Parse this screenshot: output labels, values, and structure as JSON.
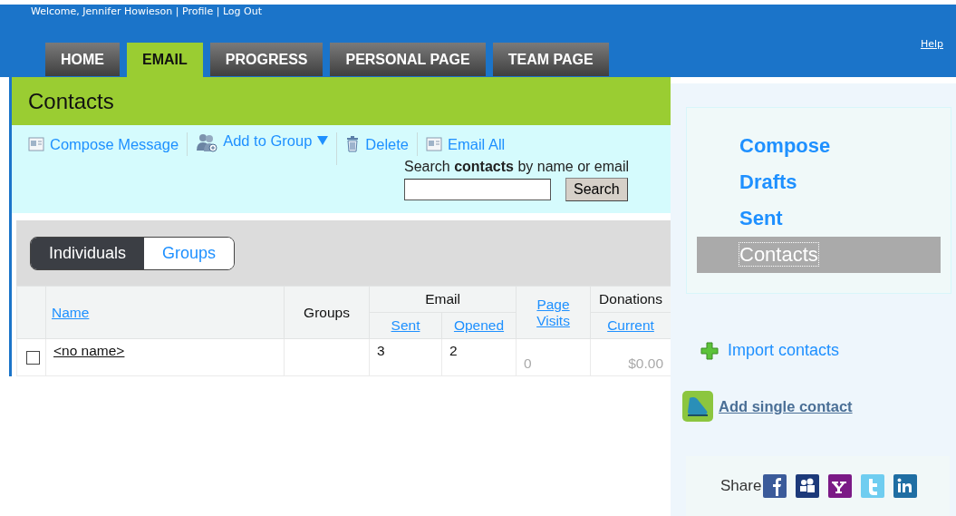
{
  "header": {
    "welcome": "Welcome, Jennifer Howieson",
    "links": [
      {
        "label": "Profile"
      },
      {
        "label": "Log Out"
      }
    ],
    "separators": [
      "|",
      "|"
    ],
    "help": "Help"
  },
  "tabs": [
    {
      "label": "HOME",
      "selected": false
    },
    {
      "label": "EMAIL",
      "selected": true
    },
    {
      "label": "PROGRESS",
      "selected": false
    },
    {
      "label": "PERSONAL PAGE",
      "selected": false
    },
    {
      "label": "TEAM PAGE",
      "selected": false
    }
  ],
  "page_title": "Contacts",
  "toolbar": {
    "actions": [
      {
        "label": "Compose Message",
        "kind": "message",
        "dropdown": false
      },
      {
        "label": "Add to Group",
        "kind": "people",
        "dropdown": true
      },
      {
        "label": "Delete",
        "kind": "trash",
        "dropdown": false
      },
      {
        "label": "Email All",
        "kind": "message",
        "dropdown": false
      }
    ],
    "search": {
      "label": "Search **contacts** by name or email",
      "button": "Search"
    }
  },
  "view_toggle": [
    {
      "label": "Individuals",
      "selected": true
    },
    {
      "label": "Groups",
      "selected": false
    }
  ],
  "table": {
    "columns": {
      "name": "Name",
      "groups": "Groups",
      "email": "Email",
      "sent": "Sent",
      "opened": "Opened",
      "page_visits": "Page Visits",
      "donations": "Donations",
      "current": "Current"
    },
    "rows": [
      {
        "checked": false,
        "name": "<no name>",
        "groups": "",
        "sent": "3",
        "opened": "2",
        "page_visits": "0",
        "current": "$0.00"
      }
    ]
  },
  "sidebar": {
    "nav": [
      {
        "label": "Compose",
        "selected": false
      },
      {
        "label": "Drafts",
        "selected": false
      },
      {
        "label": "Sent",
        "selected": false
      },
      {
        "label": "Contacts",
        "selected": true
      }
    ],
    "import": "Import contacts",
    "add_single": "Add single contact",
    "share": {
      "label": "Share",
      "services": [
        {
          "kind": "facebook"
        },
        {
          "kind": "myspace"
        },
        {
          "kind": "yahoo"
        },
        {
          "kind": "twitter"
        },
        {
          "kind": "linkedin"
        }
      ]
    }
  }
}
